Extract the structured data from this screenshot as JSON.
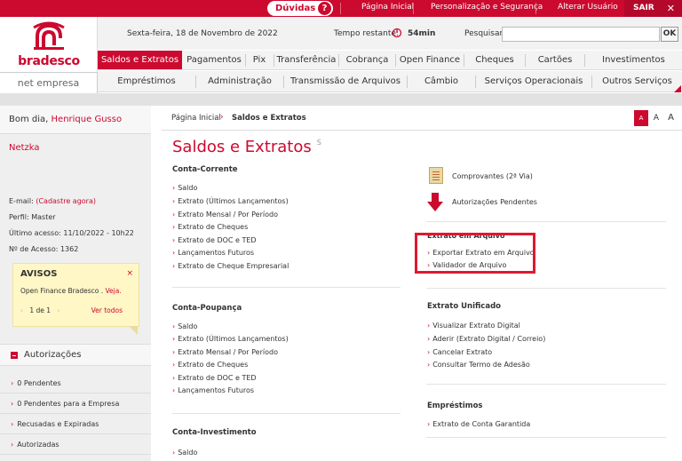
{
  "topbar": {
    "duvidas": "Dúvidas",
    "duvidas_icon": "question-icon",
    "links": [
      "Página Inicial",
      "Personalização e Segurança",
      "Alterar Usuário"
    ],
    "sair": "SAIR"
  },
  "logo": {
    "brand": "bradesco",
    "subtitle": "net empresa"
  },
  "info": {
    "date": "Sexta-feira, 18 de Novembro de 2022",
    "tempo_label": "Tempo restante:",
    "tempo_value": "54min",
    "pesquisar_label": "Pesquisar:",
    "search_value": "",
    "ok": "OK"
  },
  "nav1": [
    "Saldos e Extratos",
    "Pagamentos",
    "Pix",
    "Transferência",
    "Cobrança",
    "Open Finance",
    "Cheques",
    "Cartões",
    "Investimentos"
  ],
  "nav2": [
    "Empréstimos",
    "Administração",
    "Transmissão de Arquivos",
    "Câmbio",
    "Serviços Operacionais",
    "Outros Serviços"
  ],
  "sidebar": {
    "greeting": "Bom dia,",
    "user_name": "Henrique Gusso Netzka",
    "email_label": "E-mail:",
    "email_link": "(Cadastre agora)",
    "perfil": "Perfil: Master",
    "ultimo_acesso": "Último acesso: 11/10/2022 - 10h22",
    "nro_acesso": "Nº de Acesso: 1362",
    "avisos": {
      "title": "AVISOS",
      "close": "×",
      "body": "Open Finance Bradesco .",
      "link": "Veja.",
      "prev": "‹",
      "page": "1 de 1",
      "next": "›",
      "ver_todos": "Ver todos"
    },
    "autorizacoes_title": "Autorizações",
    "autorizacoes": [
      "0 Pendentes",
      "0 Pendentes para a Empresa",
      "Recusadas e Expiradas",
      "Autorizadas"
    ]
  },
  "breadcrumb": {
    "home": "Página Inicial",
    "current": "Saldos e Extratos"
  },
  "font_sizes": [
    "A",
    "A",
    "A"
  ],
  "page_title": "Saldos e Extratos",
  "page_title_suffix": "S",
  "sections": {
    "conta_corrente": {
      "title": "Conta-Corrente",
      "items": [
        "Saldo",
        "Extrato (Últimos Lançamentos)",
        "Extrato Mensal / Por Período",
        "Extrato de Cheques",
        "Extrato de DOC e TED",
        "Lançamentos Futuros",
        "Extrato de Cheque Empresarial"
      ]
    },
    "conta_poupanca": {
      "title": "Conta-Poupança",
      "items": [
        "Saldo",
        "Extrato (Últimos Lançamentos)",
        "Extrato Mensal / Por Período",
        "Extrato de Cheques",
        "Extrato de DOC e TED",
        "Lançamentos Futuros"
      ]
    },
    "conta_investimento": {
      "title": "Conta-Investimento",
      "items": [
        "Saldo"
      ]
    },
    "right_links": [
      "Comprovantes (2ª Via)",
      "Autorizações Pendentes"
    ],
    "extrato_arquivo": {
      "title": "Extrato em Arquivo",
      "items": [
        "Exportar Extrato em Arquivo",
        "Validador de Arquivo"
      ]
    },
    "extrato_unificado": {
      "title": "Extrato Unificado",
      "items": [
        "Visualizar Extrato Digital",
        "Aderir (Extrato Digital / Correio)",
        "Cancelar Extrato",
        "Consultar Termo de Adesão"
      ]
    },
    "emprestimos": {
      "title": "Empréstimos",
      "items": [
        "Extrato de Conta Garantida"
      ]
    }
  },
  "colors": {
    "brand": "#cc092f",
    "highlight": "#e0182f"
  }
}
